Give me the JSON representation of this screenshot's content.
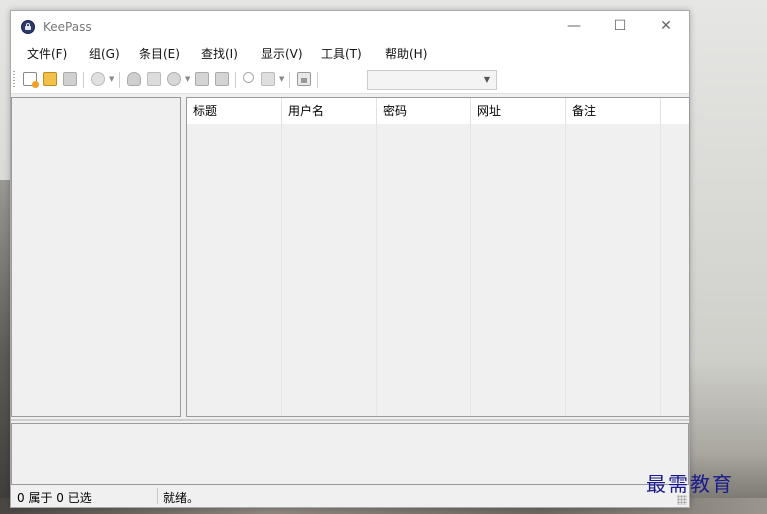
{
  "app": {
    "title": "KeePass"
  },
  "window_controls": {
    "minimize": "—",
    "maximize": "☐",
    "close": "✕"
  },
  "menu": [
    "文件(F)",
    "组(G)",
    "条目(E)",
    "查找(I)",
    "显示(V)",
    "工具(T)",
    "帮助(H)"
  ],
  "toolbar": {
    "icons": [
      "new-database-icon",
      "open-folder-icon",
      "save-icon",
      "sync-icon",
      "add-group-icon",
      "edit-group-icon",
      "add-entry-icon",
      "copy-username-icon",
      "copy-password-icon",
      "find-icon",
      "find-dropdown-icon",
      "lock-workspace-icon"
    ],
    "quick_find_value": ""
  },
  "entry_list": {
    "columns": [
      "标题",
      "用户名",
      "密码",
      "网址",
      "备注"
    ],
    "rows": []
  },
  "status": {
    "selection": "0 属于 0 已选",
    "message": "就绪。"
  },
  "watermark": "最需教育",
  "colors": {
    "watermark": "#1a1a8c",
    "title_text": "#777777"
  }
}
